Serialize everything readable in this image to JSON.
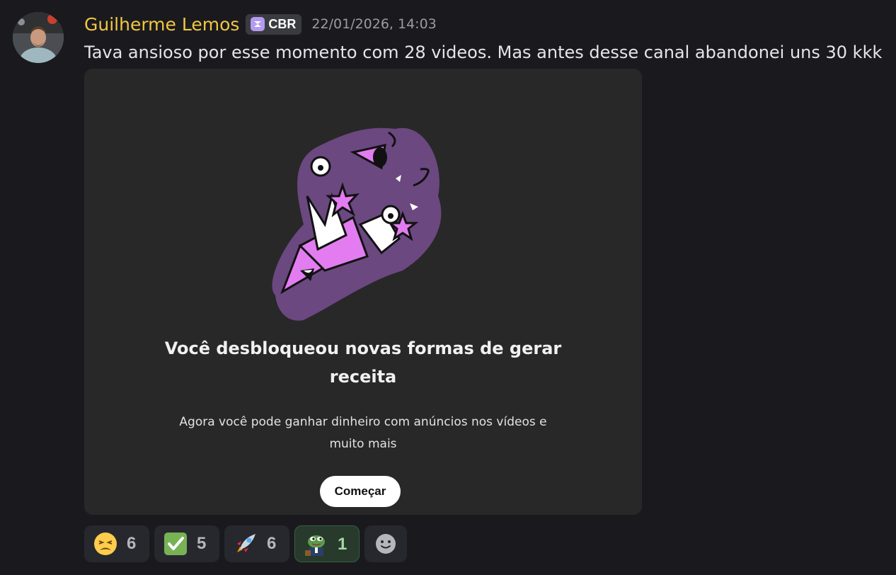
{
  "message": {
    "author": "Guilherme Lemos",
    "tag": "CBR",
    "timestamp": "22/01/2026, 14:03",
    "text": "Tava ansioso por esse momento com 28 videos. Mas antes desse canal abandonei uns 30 kkk"
  },
  "card": {
    "title_line1": "Você desbloqueou novas formas de gerar",
    "title_line2": "receita",
    "subtitle_line1": "Agora você pode ganhar dinheiro com anúncios nos vídeos e",
    "subtitle_line2": "muito mais",
    "button_label": "Começar"
  },
  "reactions": [
    {
      "emoji": "weary-face",
      "count": "6"
    },
    {
      "emoji": "check-mark-button",
      "count": "5"
    },
    {
      "emoji": "rocket",
      "count": "6"
    },
    {
      "emoji": "pepe-frog",
      "count": "1",
      "active": true
    }
  ],
  "colors": {
    "background": "#1a1a1e",
    "username": "#f0c743",
    "card": "#282828",
    "illustration_purple": "#6b4880",
    "illustration_pink": "#e27cf0",
    "active_reaction": "#273a2b"
  }
}
